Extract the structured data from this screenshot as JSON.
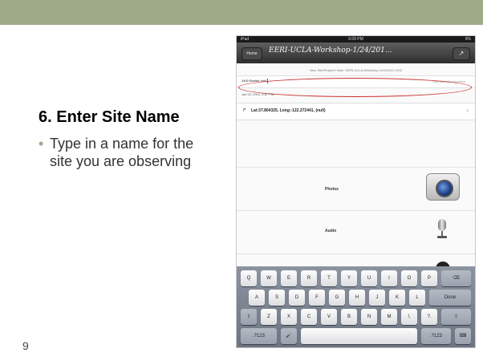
{
  "slide": {
    "title": "6. Enter Site Name",
    "bullet_marker": "•",
    "bullet_text": "Type in a name for the site you are observing",
    "page_number": "9",
    "colors": {
      "band": "#9eaa88",
      "highlight_oval": "#c9302c"
    }
  },
  "ipad": {
    "status": {
      "left": "iPad",
      "time": "6:09 PM",
      "right": "9%"
    },
    "nav": {
      "back_label": "Home",
      "title": "EERI-UCLA-Workshop-1/24/201...",
      "share_icon": "share-icon",
      "share_glyph": "↗"
    },
    "folder_line": "New Title/Project Folder: EERI-UCLA-Workshop-1/24/2013, DH2",
    "site_name": {
      "value": "3400 Boelter Hall",
      "hint": "Site Name/Designation"
    },
    "date": "Jan 22, 2013, 5:57 PM",
    "location": {
      "icon": "↱",
      "text": "Lat:37.804325, Long:-122.272441, (null)",
      "chevron": "›"
    },
    "media": [
      {
        "label": "Photos",
        "icon": "camera-icon"
      },
      {
        "label": "Audio",
        "icon": "microphone-icon"
      }
    ],
    "keyboard": {
      "row1": [
        "Q",
        "W",
        "E",
        "R",
        "T",
        "Y",
        "U",
        "I",
        "O",
        "P",
        "⌫"
      ],
      "row2": [
        "A",
        "S",
        "D",
        "F",
        "G",
        "H",
        "J",
        "K",
        "L",
        "Done"
      ],
      "row3": [
        "⇧",
        "Z",
        "X",
        "C",
        "V",
        "B",
        "N",
        "M",
        "!,",
        "?.",
        "⇧"
      ],
      "row4": [
        ".?123",
        "🎤",
        "",
        ".?123",
        "⌨"
      ]
    }
  }
}
